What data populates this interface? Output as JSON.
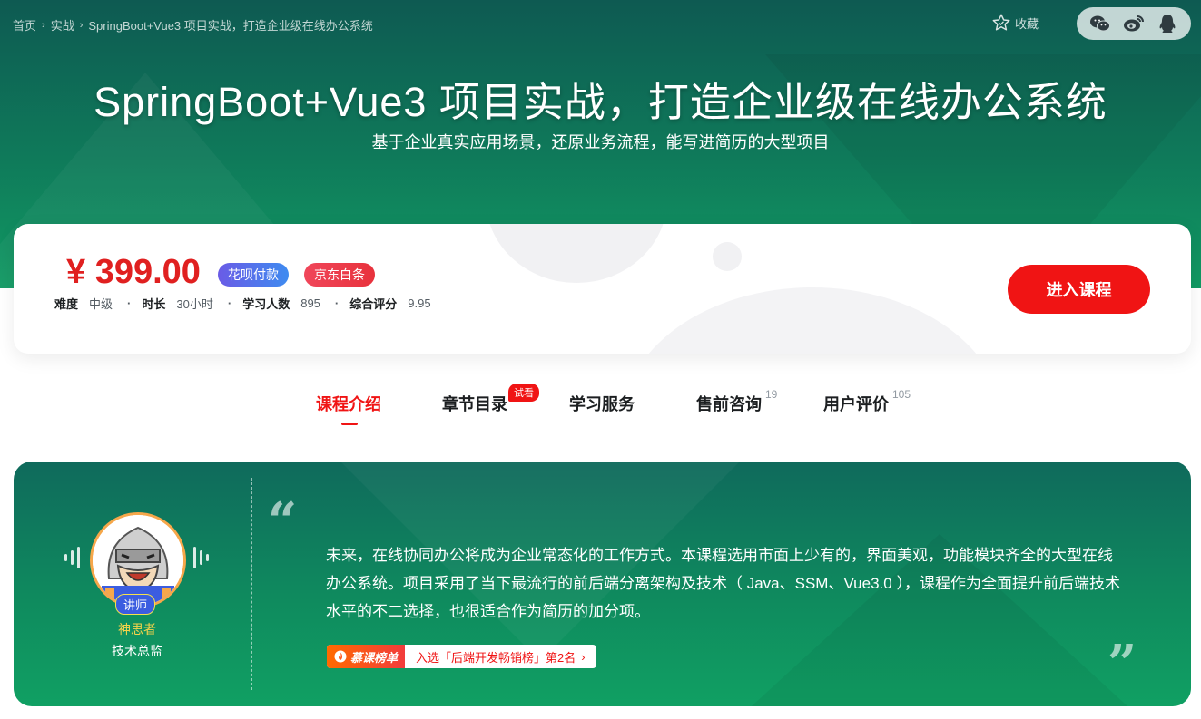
{
  "breadcrumb": [
    "首页",
    "实战",
    "SpringBoot+Vue3 项目实战，打造企业级在线办公系统"
  ],
  "header": {
    "favorite_label": "收藏",
    "share_icons": [
      "wechat-icon",
      "weibo-icon",
      "qq-icon"
    ]
  },
  "hero": {
    "title": "SpringBoot+Vue3 项目实战，打造企业级在线办公系统",
    "subtitle": "基于企业真实应用场景，还原业务流程，能写进简历的大型项目"
  },
  "purchase": {
    "price": "¥ 399.00",
    "badges": [
      "花呗付款",
      "京东白条"
    ],
    "meta": [
      {
        "label": "难度",
        "value": "中级"
      },
      {
        "label": "时长",
        "value": "30小时"
      },
      {
        "label": "学习人数",
        "value": "895"
      },
      {
        "label": "综合评分",
        "value": "9.95"
      }
    ],
    "enter_label": "进入课程"
  },
  "tabs": [
    {
      "label": "课程介绍",
      "count": ""
    },
    {
      "label": "章节目录",
      "count": ""
    },
    {
      "label": "学习服务",
      "count": ""
    },
    {
      "label": "售前咨询",
      "count": "19"
    },
    {
      "label": "用户评价",
      "count": "105"
    }
  ],
  "try_badge": "试看",
  "intro": {
    "teacher_role": "讲师",
    "teacher_name": "神思者",
    "teacher_title": "技术总监",
    "description": "未来，在线协同办公将成为企业常态化的工作方式。本课程选用市面上少有的，界面美观，功能模块齐全的大型在线办公系统。项目采用了当下最流行的前后端分离架构及技术（ Java、SSM、Vue3.0 ），课程作为全面提升前后端技术水平的不二选择，也很适合作为简历的加分项。",
    "rank_tag": "慕课榜单",
    "rank_text": "入选「后端开发畅销榜」第2名",
    "rank_arrow": "›"
  },
  "colors": {
    "accent_red": "#f01414",
    "hero_green": "#0f7a5a"
  }
}
